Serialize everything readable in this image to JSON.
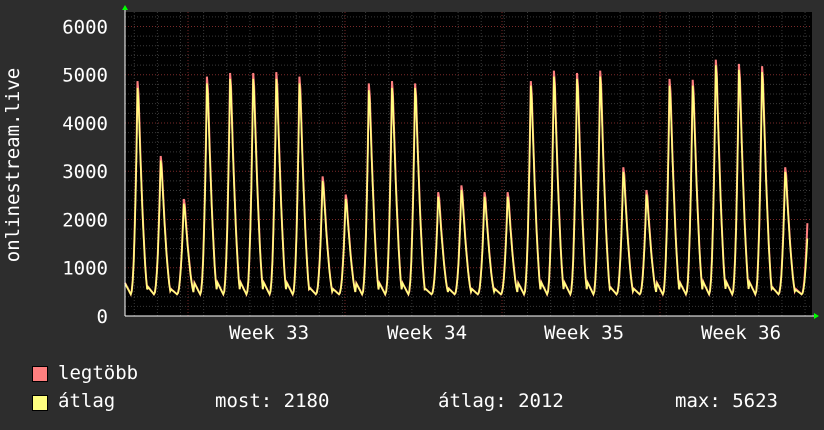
{
  "chart_data": {
    "type": "line",
    "ylabel": "onlinestream.live",
    "ylim": [
      0,
      6300
    ],
    "yticks": [
      0,
      1000,
      2000,
      3000,
      4000,
      5000,
      6000
    ],
    "x_labels": [
      "Week 33",
      "Week 34",
      "Week 35",
      "Week 36"
    ],
    "grid": true,
    "legend_position": "bottom-left",
    "series": [
      {
        "name": "legtöbb",
        "color": "#ff7f7f",
        "daily_peaks": [
          5150,
          3500,
          2550,
          5250,
          5330,
          5330,
          5350,
          5250,
          3050,
          2650,
          5100,
          5150,
          5100,
          2700,
          2850,
          2700,
          2700,
          5150,
          5380,
          5330,
          5380,
          3250,
          2750,
          5200,
          5180,
          5623,
          5530,
          5480,
          3250,
          2650
        ]
      },
      {
        "name": "átlag",
        "color": "#ffff7f",
        "daily_peaks": [
          5000,
          3400,
          2450,
          5100,
          5200,
          5200,
          5200,
          5100,
          2950,
          2550,
          4950,
          5000,
          5000,
          2600,
          2750,
          2600,
          2600,
          5050,
          5250,
          5200,
          5250,
          3150,
          2650,
          5050,
          5050,
          5500,
          5400,
          5350,
          3150,
          2180
        ]
      }
    ]
  },
  "legend": {
    "max_label": "legtöbb",
    "avg_label": "átlag",
    "max_color": "#ff7f7f",
    "avg_color": "#ffff7f"
  },
  "stats": {
    "now": "most: 2180",
    "avg": "átlag: 2012",
    "max": "max: 5623"
  }
}
